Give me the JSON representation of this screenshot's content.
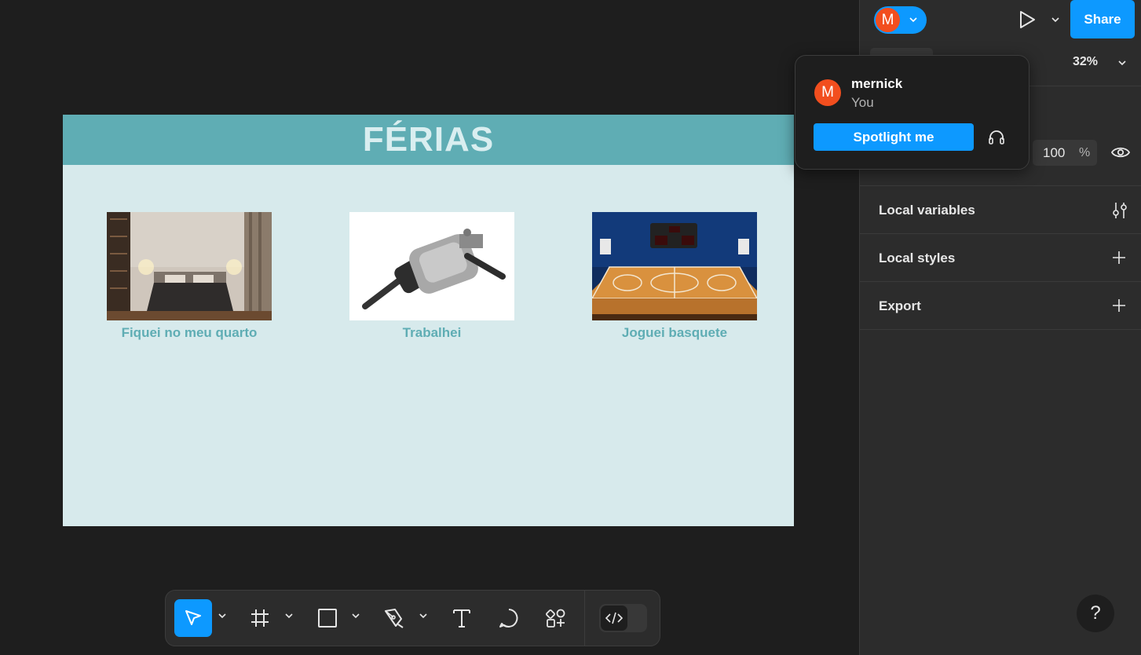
{
  "frame": {
    "title": "FÉRIAS",
    "cards": [
      {
        "caption": "Fiquei no meu quarto",
        "image": "bedroom-photo"
      },
      {
        "caption": "Trabalhei",
        "image": "mechanical-part-photo"
      },
      {
        "caption": "Joguei basquete",
        "image": "basketball-court-illustration"
      }
    ]
  },
  "toolbar": {
    "tools": [
      "move-icon",
      "frame-icon",
      "rectangle-icon",
      "pen-icon",
      "text-icon",
      "comment-icon",
      "actions-icon"
    ],
    "dev_mode_icon": "code-icon"
  },
  "header": {
    "avatar_initial": "M",
    "share_label": "Share",
    "zoom": "32%"
  },
  "popover": {
    "avatar_initial": "M",
    "name": "mernick",
    "subtitle": "You",
    "spotlight_label": "Spotlight me"
  },
  "layer": {
    "opacity_value": "100",
    "opacity_unit": "%"
  },
  "panel_sections": {
    "local_variables": "Local variables",
    "local_styles": "Local styles",
    "export": "Export"
  },
  "help_label": "?",
  "colors": {
    "accent": "#0d99ff",
    "avatar": "#f24e1e",
    "frame_header": "#5fadb4",
    "frame_background": "#d7eaec"
  }
}
